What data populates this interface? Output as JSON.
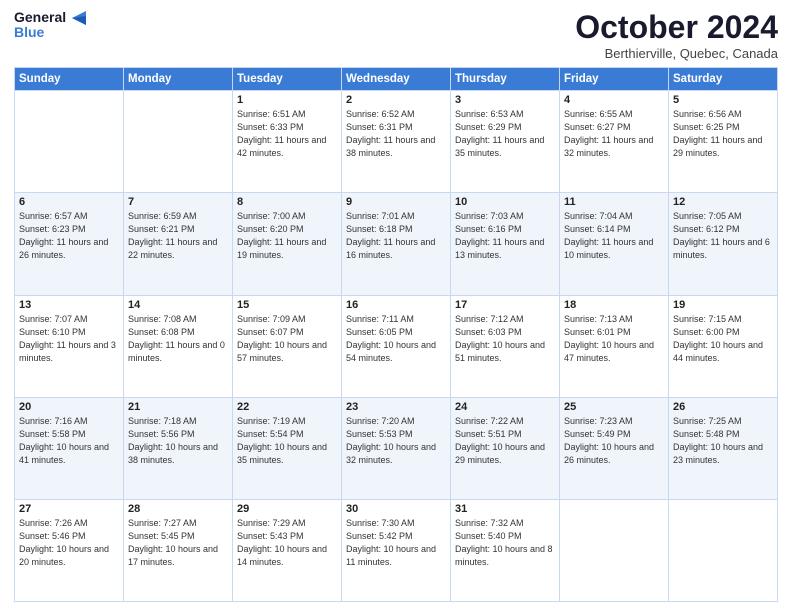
{
  "logo": {
    "line1": "General",
    "line2": "Blue"
  },
  "title": "October 2024",
  "location": "Berthierville, Quebec, Canada",
  "headers": [
    "Sunday",
    "Monday",
    "Tuesday",
    "Wednesday",
    "Thursday",
    "Friday",
    "Saturday"
  ],
  "weeks": [
    [
      {
        "day": "",
        "sunrise": "",
        "sunset": "",
        "daylight": ""
      },
      {
        "day": "",
        "sunrise": "",
        "sunset": "",
        "daylight": ""
      },
      {
        "day": "1",
        "sunrise": "Sunrise: 6:51 AM",
        "sunset": "Sunset: 6:33 PM",
        "daylight": "Daylight: 11 hours and 42 minutes."
      },
      {
        "day": "2",
        "sunrise": "Sunrise: 6:52 AM",
        "sunset": "Sunset: 6:31 PM",
        "daylight": "Daylight: 11 hours and 38 minutes."
      },
      {
        "day": "3",
        "sunrise": "Sunrise: 6:53 AM",
        "sunset": "Sunset: 6:29 PM",
        "daylight": "Daylight: 11 hours and 35 minutes."
      },
      {
        "day": "4",
        "sunrise": "Sunrise: 6:55 AM",
        "sunset": "Sunset: 6:27 PM",
        "daylight": "Daylight: 11 hours and 32 minutes."
      },
      {
        "day": "5",
        "sunrise": "Sunrise: 6:56 AM",
        "sunset": "Sunset: 6:25 PM",
        "daylight": "Daylight: 11 hours and 29 minutes."
      }
    ],
    [
      {
        "day": "6",
        "sunrise": "Sunrise: 6:57 AM",
        "sunset": "Sunset: 6:23 PM",
        "daylight": "Daylight: 11 hours and 26 minutes."
      },
      {
        "day": "7",
        "sunrise": "Sunrise: 6:59 AM",
        "sunset": "Sunset: 6:21 PM",
        "daylight": "Daylight: 11 hours and 22 minutes."
      },
      {
        "day": "8",
        "sunrise": "Sunrise: 7:00 AM",
        "sunset": "Sunset: 6:20 PM",
        "daylight": "Daylight: 11 hours and 19 minutes."
      },
      {
        "day": "9",
        "sunrise": "Sunrise: 7:01 AM",
        "sunset": "Sunset: 6:18 PM",
        "daylight": "Daylight: 11 hours and 16 minutes."
      },
      {
        "day": "10",
        "sunrise": "Sunrise: 7:03 AM",
        "sunset": "Sunset: 6:16 PM",
        "daylight": "Daylight: 11 hours and 13 minutes."
      },
      {
        "day": "11",
        "sunrise": "Sunrise: 7:04 AM",
        "sunset": "Sunset: 6:14 PM",
        "daylight": "Daylight: 11 hours and 10 minutes."
      },
      {
        "day": "12",
        "sunrise": "Sunrise: 7:05 AM",
        "sunset": "Sunset: 6:12 PM",
        "daylight": "Daylight: 11 hours and 6 minutes."
      }
    ],
    [
      {
        "day": "13",
        "sunrise": "Sunrise: 7:07 AM",
        "sunset": "Sunset: 6:10 PM",
        "daylight": "Daylight: 11 hours and 3 minutes."
      },
      {
        "day": "14",
        "sunrise": "Sunrise: 7:08 AM",
        "sunset": "Sunset: 6:08 PM",
        "daylight": "Daylight: 11 hours and 0 minutes."
      },
      {
        "day": "15",
        "sunrise": "Sunrise: 7:09 AM",
        "sunset": "Sunset: 6:07 PM",
        "daylight": "Daylight: 10 hours and 57 minutes."
      },
      {
        "day": "16",
        "sunrise": "Sunrise: 7:11 AM",
        "sunset": "Sunset: 6:05 PM",
        "daylight": "Daylight: 10 hours and 54 minutes."
      },
      {
        "day": "17",
        "sunrise": "Sunrise: 7:12 AM",
        "sunset": "Sunset: 6:03 PM",
        "daylight": "Daylight: 10 hours and 51 minutes."
      },
      {
        "day": "18",
        "sunrise": "Sunrise: 7:13 AM",
        "sunset": "Sunset: 6:01 PM",
        "daylight": "Daylight: 10 hours and 47 minutes."
      },
      {
        "day": "19",
        "sunrise": "Sunrise: 7:15 AM",
        "sunset": "Sunset: 6:00 PM",
        "daylight": "Daylight: 10 hours and 44 minutes."
      }
    ],
    [
      {
        "day": "20",
        "sunrise": "Sunrise: 7:16 AM",
        "sunset": "Sunset: 5:58 PM",
        "daylight": "Daylight: 10 hours and 41 minutes."
      },
      {
        "day": "21",
        "sunrise": "Sunrise: 7:18 AM",
        "sunset": "Sunset: 5:56 PM",
        "daylight": "Daylight: 10 hours and 38 minutes."
      },
      {
        "day": "22",
        "sunrise": "Sunrise: 7:19 AM",
        "sunset": "Sunset: 5:54 PM",
        "daylight": "Daylight: 10 hours and 35 minutes."
      },
      {
        "day": "23",
        "sunrise": "Sunrise: 7:20 AM",
        "sunset": "Sunset: 5:53 PM",
        "daylight": "Daylight: 10 hours and 32 minutes."
      },
      {
        "day": "24",
        "sunrise": "Sunrise: 7:22 AM",
        "sunset": "Sunset: 5:51 PM",
        "daylight": "Daylight: 10 hours and 29 minutes."
      },
      {
        "day": "25",
        "sunrise": "Sunrise: 7:23 AM",
        "sunset": "Sunset: 5:49 PM",
        "daylight": "Daylight: 10 hours and 26 minutes."
      },
      {
        "day": "26",
        "sunrise": "Sunrise: 7:25 AM",
        "sunset": "Sunset: 5:48 PM",
        "daylight": "Daylight: 10 hours and 23 minutes."
      }
    ],
    [
      {
        "day": "27",
        "sunrise": "Sunrise: 7:26 AM",
        "sunset": "Sunset: 5:46 PM",
        "daylight": "Daylight: 10 hours and 20 minutes."
      },
      {
        "day": "28",
        "sunrise": "Sunrise: 7:27 AM",
        "sunset": "Sunset: 5:45 PM",
        "daylight": "Daylight: 10 hours and 17 minutes."
      },
      {
        "day": "29",
        "sunrise": "Sunrise: 7:29 AM",
        "sunset": "Sunset: 5:43 PM",
        "daylight": "Daylight: 10 hours and 14 minutes."
      },
      {
        "day": "30",
        "sunrise": "Sunrise: 7:30 AM",
        "sunset": "Sunset: 5:42 PM",
        "daylight": "Daylight: 10 hours and 11 minutes."
      },
      {
        "day": "31",
        "sunrise": "Sunrise: 7:32 AM",
        "sunset": "Sunset: 5:40 PM",
        "daylight": "Daylight: 10 hours and 8 minutes."
      },
      {
        "day": "",
        "sunrise": "",
        "sunset": "",
        "daylight": ""
      },
      {
        "day": "",
        "sunrise": "",
        "sunset": "",
        "daylight": ""
      }
    ]
  ]
}
